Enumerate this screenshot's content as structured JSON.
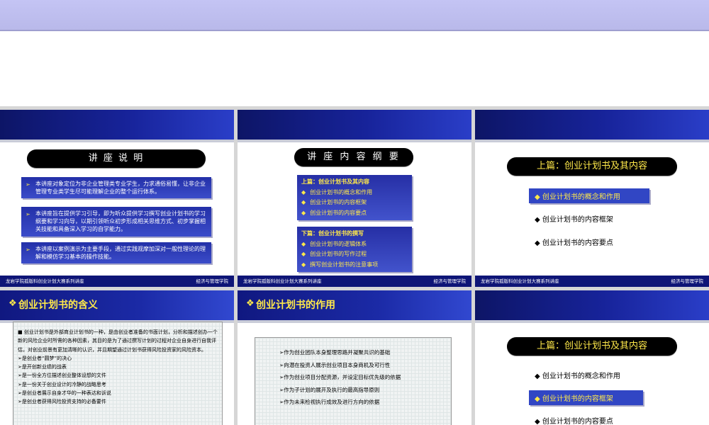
{
  "footer": {
    "left": "龙岩学院孤版科创业计划大赛系列讲座",
    "right": "经济与管理学院"
  },
  "slide1": {
    "title": "讲 座 说 明",
    "items": [
      "本讲座对象定位为非企业管理类专业学生，力求通俗易懂，让非企业管理专业类学生尽可能理解企业的整个运行体系。",
      "本讲座旨在提供学习引导，即为听众提供学习撰写创业计划书的学习纲要和学习向导，以期引领听众初步形成相关思维方式、初步掌握相关技能和具备深入学习的自学能力。",
      "本讲座以案例演示为主要手段，通过实践观摩加深对一般性理论的理解和模仿学习基本的操作技能。"
    ]
  },
  "slide2": {
    "title": "讲 座 内 容 纲 要",
    "part1": {
      "head": "上篇：创业计划书及其内容",
      "items": [
        "创业计划书的概念和作用",
        "创业计划书的内容框架",
        "创业计划书的内容要点"
      ]
    },
    "part2": {
      "head": "下篇：创业计划书的撰写",
      "items": [
        "创业计划书的逻辑体系",
        "创业计划书的写作过程",
        "撰写创业计划书的注意事项"
      ]
    }
  },
  "slide3": {
    "title": "上篇：创业计划书及其内容",
    "items": [
      "创业计划书的概念和作用",
      "创业计划书的内容框架",
      "创业计划书的内容要点"
    ]
  },
  "slide4": {
    "title": "创业计划书的含义",
    "intro": "创业计划书是外部商业计划书的一种，是由创业者准备的书面计划，分析和描述创办一个新的风险企业时所需的各种因素，其目的是为了通过撰写计划的过程对企业自身进行自我评估，对创业前景有更加清晰的认识，并且期望通过计划书获得风险投资家的风险资本。",
    "items": [
      "是创业者“圆梦”的决心",
      "是开创新业绩的战表",
      "是一份全方位描述创业整体设想的文件",
      "是一份关于创业设计的冷静的战略思考",
      "是创业者展示自身才华的一种表达和诉说",
      "是创业者获得风险投资支持的必备要件"
    ]
  },
  "slide5": {
    "title": "创业计划书的作用",
    "items": [
      "作为创业团队本身整理思路并凝聚共识的基础",
      "向潜在投资人展示创业项目本身商机及可行性",
      "作为创业项目分配资源，并设定目标优先级的依据",
      "作为子计划的展开及执行的最高指导原则",
      "作为未来检视执行成效及进行方向的依据"
    ]
  },
  "slide6": {
    "title": "上篇：创业计划书及其内容",
    "items": [
      "创业计划书的概念和作用",
      "创业计划书的内容框架",
      "创业计划书的内容要点"
    ]
  },
  "colors": {
    "header_blue": "#17239a",
    "accent_yellow": "#ffe94a",
    "highlight_blue": "#3146c4"
  }
}
